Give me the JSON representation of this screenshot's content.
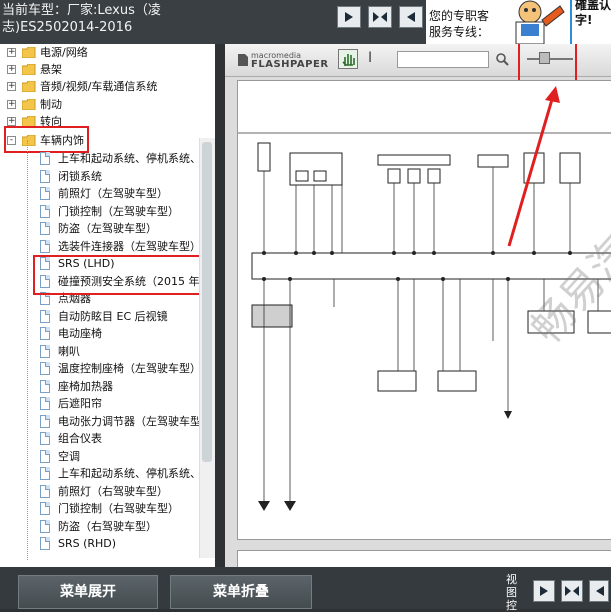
{
  "header": {
    "car_model": "当前车型：厂家:Lexus（凌志)ES2502014-2016",
    "nav": [
      "first-page",
      "fit-page",
      "last-page"
    ],
    "hotline": "您的专职客服务专线：",
    "bubble": "確盖认字!"
  },
  "sidebar": {
    "folders": [
      {
        "label": "电源/网络",
        "expander": "+"
      },
      {
        "label": "悬架",
        "expander": "+"
      },
      {
        "label": "音频/视频/车载通信系统",
        "expander": "+"
      },
      {
        "label": "制动",
        "expander": "+"
      },
      {
        "label": "转向",
        "expander": "+"
      },
      {
        "label": "车辆内饰",
        "expander": "-"
      }
    ],
    "items": [
      "上车和起动系统、停机系统、",
      "闭锁系统",
      "前照灯（左驾驶车型）",
      "门锁控制（左驾驶车型）",
      "防盗（左驾驶车型）",
      "选装件连接器（左驾驶车型）",
      "SRS (LHD)",
      "碰撞预测安全系统（2015 年",
      "点烟器",
      "自动防眩目 EC 后视镜",
      "电动座椅",
      "喇叭",
      "温度控制座椅（左驾驶车型）",
      "座椅加热器",
      "后遮阳帘",
      "电动张力调节器（左驾驶车型",
      "组合仪表",
      "空调",
      "上车和起动系统、停机系统、",
      "前照灯（右驾驶车型）",
      "门锁控制（右驾驶车型）",
      "防盗（右驾驶车型）",
      "SRS (RHD)"
    ]
  },
  "viewer": {
    "logo_line1": "macromedia",
    "logo_line2": "FLASHPAPER",
    "text_tool": "I",
    "search_value": "",
    "watermark": "畅易汽维修"
  },
  "footer": {
    "expand_label": "菜单展开",
    "collapse_label": "菜单折叠",
    "zoom_label": "视图控"
  },
  "colors": {
    "highlight": "#e02020",
    "folder": "#f3c64a",
    "topbar": "#3a3f43"
  }
}
